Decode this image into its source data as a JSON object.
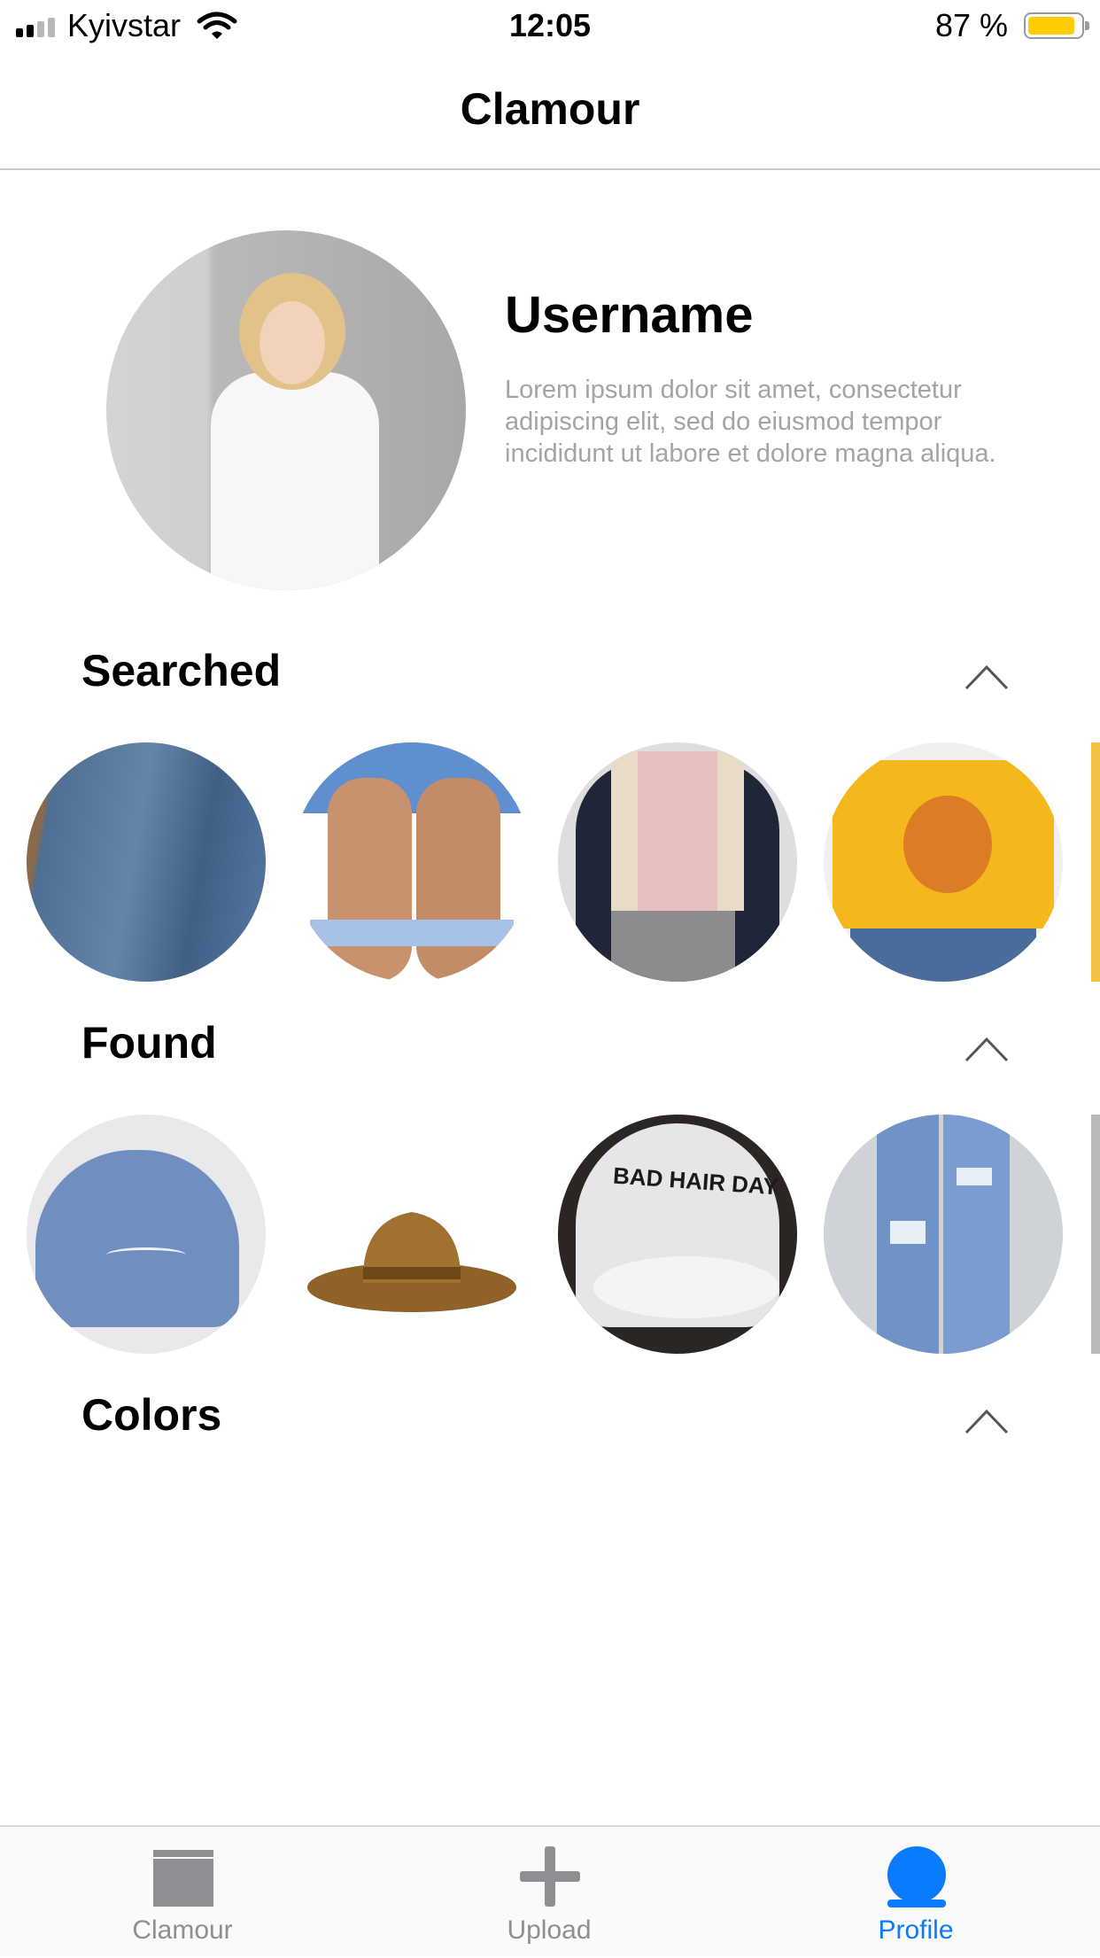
{
  "status_bar": {
    "carrier": "Kyivstar",
    "time": "12:05",
    "battery_percent": "87 %",
    "battery_level": 0.87,
    "battery_color": "#ffcc00"
  },
  "nav": {
    "title": "Clamour"
  },
  "profile": {
    "username": "Username",
    "bio": "Lorem ipsum dolor sit amet, consectetur adipiscing elit, sed do eiusmod tempor incididunt ut labore et dolore magna aliqua."
  },
  "sections": {
    "searched": {
      "title": "Searched"
    },
    "found": {
      "title": "Found"
    },
    "colors": {
      "title": "Colors"
    }
  },
  "tabbar": {
    "tabs": [
      {
        "label": "Clamour",
        "icon": "card-icon",
        "active": false
      },
      {
        "label": "Upload",
        "icon": "plus-icon",
        "active": false
      },
      {
        "label": "Profile",
        "icon": "person-icon",
        "active": true
      }
    ],
    "active_color": "#0a7aff",
    "inactive_color": "#8e8e93"
  }
}
